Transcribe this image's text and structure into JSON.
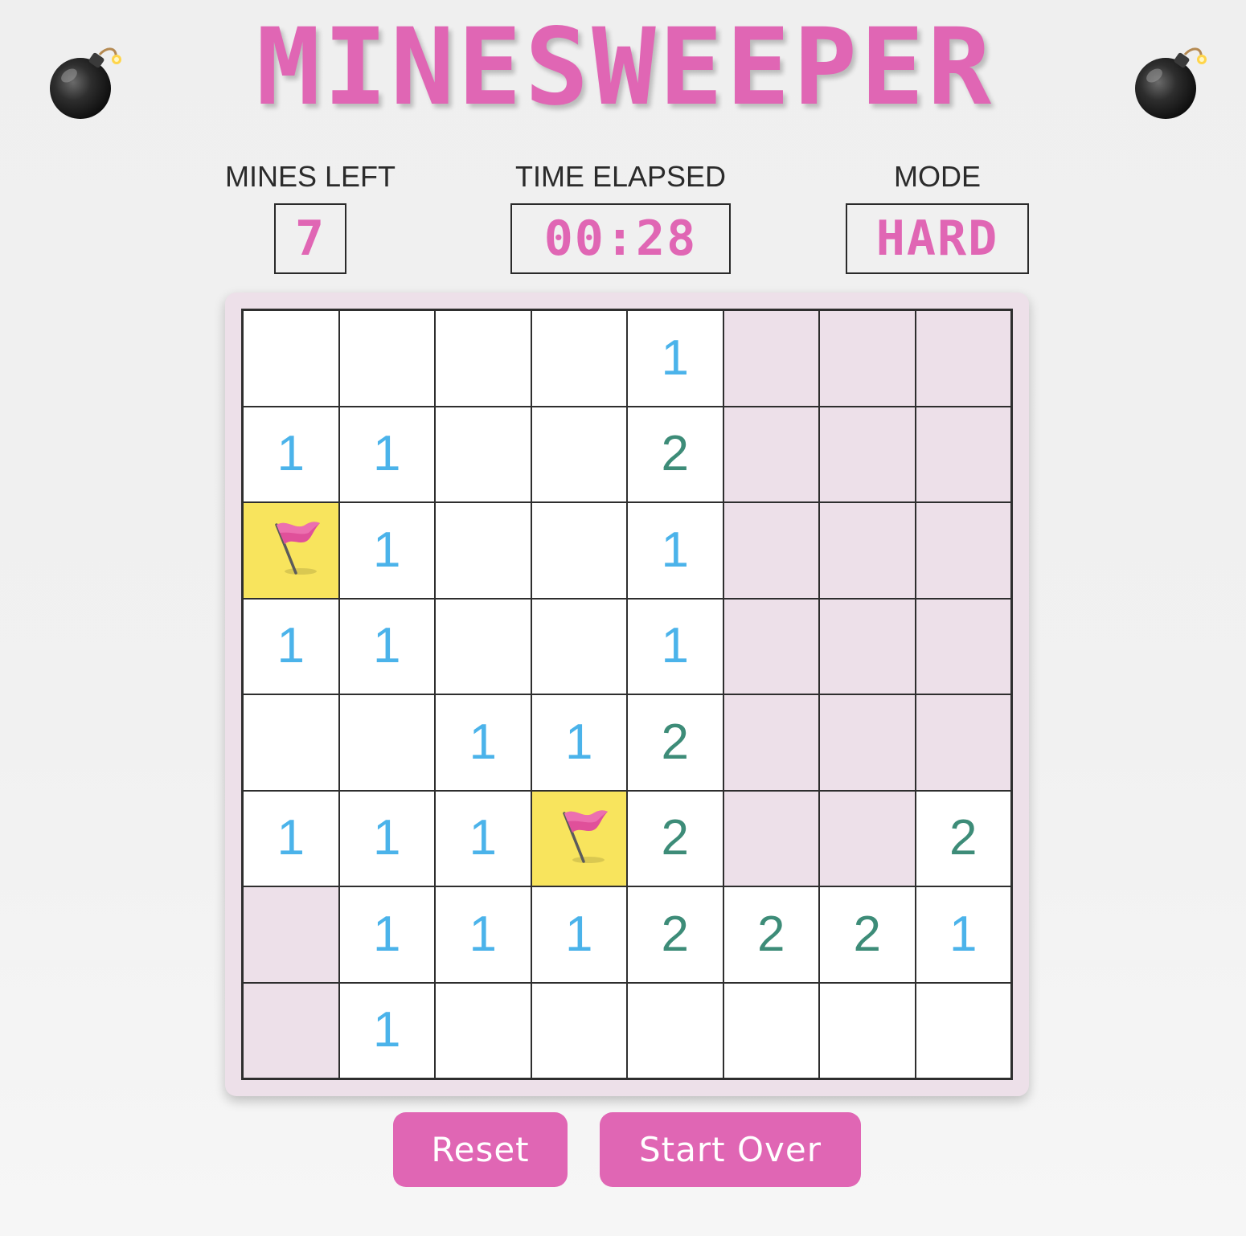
{
  "title": "MINESWEEPER",
  "stats": {
    "mines_left_label": "MINES LEFT",
    "mines_left_value": "7",
    "time_label": "TIME ELAPSED",
    "time_value": "00:28",
    "mode_label": "MODE",
    "mode_value": "HARD"
  },
  "board": {
    "rows": 8,
    "cols": 8,
    "cells": [
      [
        "",
        "",
        "",
        "",
        "1",
        "#",
        "#",
        "#"
      ],
      [
        "1",
        "1",
        "",
        "",
        "2",
        "#",
        "#",
        "#"
      ],
      [
        "F",
        "1",
        "",
        "",
        "1",
        "#",
        "#",
        "#"
      ],
      [
        "1",
        "1",
        "",
        "",
        "1",
        "#",
        "#",
        "#"
      ],
      [
        "",
        "",
        "1",
        "1",
        "2",
        "#",
        "#",
        "#"
      ],
      [
        "1",
        "1",
        "1",
        "F",
        "2",
        "#",
        "#",
        "2"
      ],
      [
        "#",
        "1",
        "1",
        "1",
        "2",
        "2",
        "2",
        "1"
      ],
      [
        "#",
        "1",
        "",
        "",
        "",
        "",
        "",
        ""
      ]
    ],
    "legend": {
      "": "revealed-empty",
      "#": "hidden",
      "F": "flagged"
    }
  },
  "buttons": {
    "reset_label": "Reset",
    "start_over_label": "Start Over"
  },
  "colors": {
    "accent": "#e066b4",
    "hidden_cell": "#ede0e9",
    "flag_cell": "#f8e45d",
    "number_1": "#4bb3ea",
    "number_2": "#3d8c78"
  },
  "icons": {
    "decoration": "bomb-icon",
    "flag": "flag-icon"
  }
}
